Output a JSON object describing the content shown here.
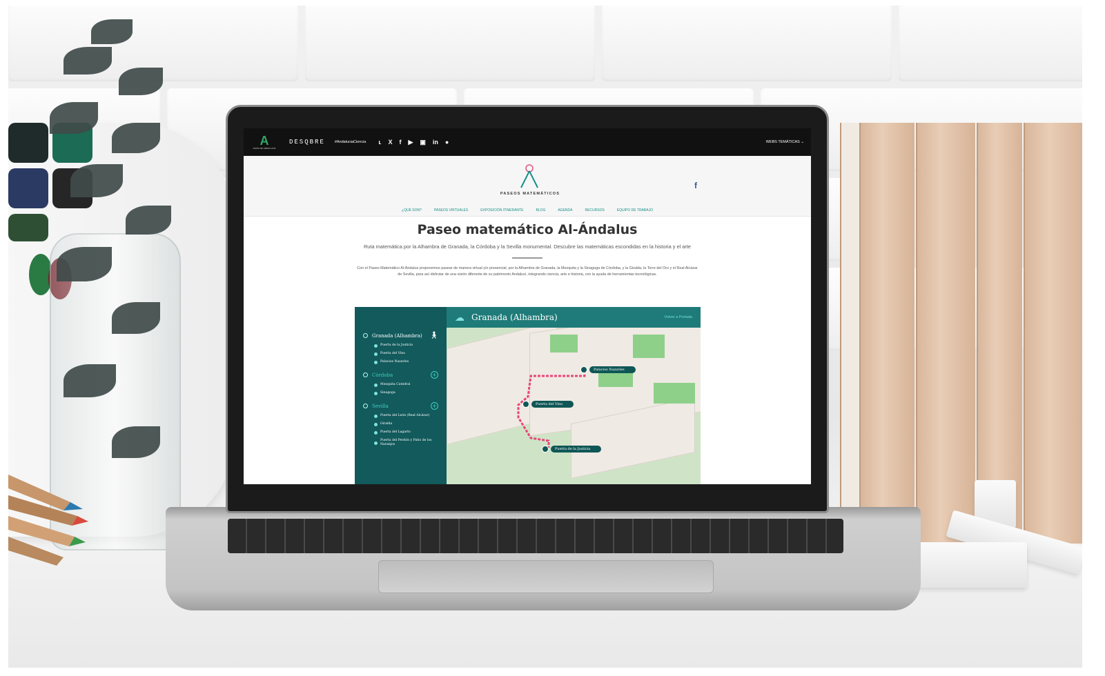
{
  "topbar": {
    "junta_logo": "A",
    "junta_text": "JUNTA DE ANDALUCÍA",
    "descubre": "DESQBRE",
    "hashtag": "#AndaluciaCiencia",
    "social_icons": [
      "rss-icon",
      "x-icon",
      "facebook-icon",
      "youtube-icon",
      "instagram-icon",
      "linkedin-icon",
      "spotify-icon"
    ],
    "social_glyphs": [
      "ʟ",
      "X",
      "f",
      "▶",
      "▣",
      "in",
      "●"
    ],
    "webs": "WEBS TEMÁTICAS ⌄"
  },
  "accessibility_glyph": "♿",
  "header": {
    "brand_name": "PASEOS MATEMÁTICOS",
    "facebook": "f",
    "nav": [
      "¿QUÉ SON?",
      "PASEOS VIRTUALES",
      "EXPOSICIÓN ITINERANTE",
      "BLOG",
      "AGENDA",
      "RECURSOS",
      "EQUIPO DE TRABAJO"
    ]
  },
  "content": {
    "title": "Paseo matemático Al-Ándalus",
    "subtitle": "Ruta matemática por la Alhambra de Granada, la Córdoba y la Sevilla monumental. Descubre las matemáticas escondidas en la historia y el arte",
    "intro": "Con el Paseo Matemático Al-Ándalus proponemos pasear de manera virtual y/o presencial, por la Alhambra de Granada, la Mezquita y la Sinagoga de Córdoba, y la Giralda, la Torre del Oro y el Real Alcázar de Sevilla, para así disfrutar de una visión diferente de su patrimonio Andalusí, integrando ciencia, arte e historia, con la ayuda de herramientas tecnológicas."
  },
  "map": {
    "header_title": "Granada (Alhambra)",
    "back_label": "Volver a Portada",
    "sidebar": [
      {
        "name": "Granada (Alhambra)",
        "items": [
          "Puerta de la Justicia",
          "Puerta del Vino",
          "Palacios Nazaríes"
        ]
      },
      {
        "name": "Córdoba",
        "items": [
          "Mezquita Catedral",
          "Sinagoga"
        ]
      },
      {
        "name": "Sevilla",
        "items": [
          "Puerta del León (Real Alcázar)",
          "Giralda",
          "Puerta del Lagarto",
          "Puerta del Perdón y Patio de los Naranjos"
        ]
      }
    ],
    "pins": [
      "Palacios Nazaríes",
      "Puerta del Vino",
      "Puerta de la Justicia"
    ],
    "route_color": "#e8457a",
    "accent": "#125a5c"
  }
}
